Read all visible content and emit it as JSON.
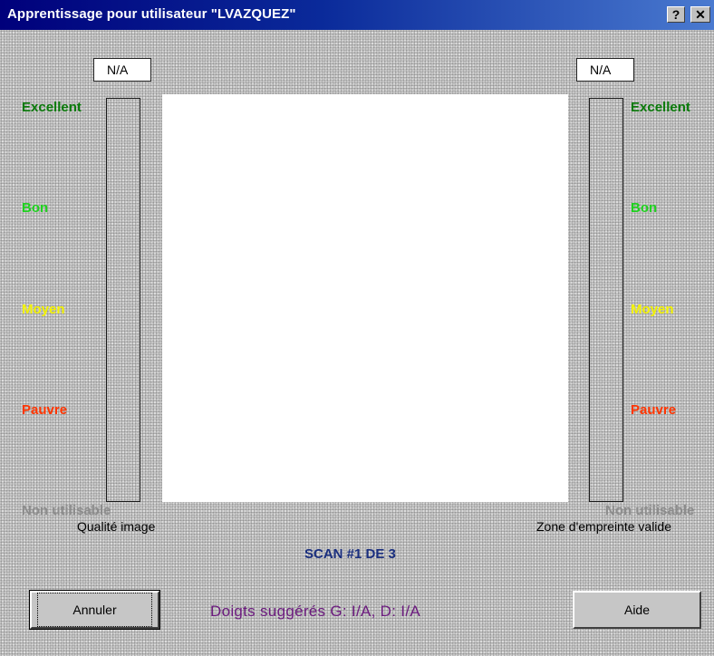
{
  "window": {
    "title": "Apprentissage pour utilisateur \"LVAZQUEZ\"",
    "help_glyph": "?",
    "close_glyph": "✕"
  },
  "left_panel": {
    "value": "N/A",
    "caption": "Qualité image",
    "levels": [
      "Excellent",
      "Bon",
      "Moyen",
      "Pauvre",
      "Non utilisable"
    ]
  },
  "right_panel": {
    "value": "N/A",
    "caption": "Zone d'empreinte valide",
    "levels": [
      "Excellent",
      "Bon",
      "Moyen",
      "Pauvre",
      "Non utilisable"
    ]
  },
  "level_colors": {
    "excellent": "#0a7a0a",
    "bon": "#1ed21e",
    "moyen": "#f2f200",
    "pauvre": "#ff3500",
    "non_utilisable": "#8c8c8c"
  },
  "scan_status": "SCAN #1 DE 3",
  "suggested_fingers": "Doigts suggérés  G: I/A, D: I/A",
  "buttons": {
    "cancel": "Annuler",
    "help": "Aide"
  }
}
